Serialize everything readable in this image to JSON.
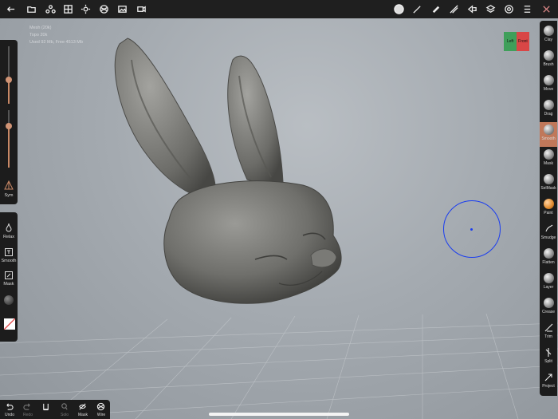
{
  "hud": {
    "line1": "Mesh (20k)",
    "line2": "Topo 20k",
    "line3": "Used 92 Mb, Free 4513 Mb"
  },
  "top_toolbar": {
    "left_icons": [
      "back-icon",
      "folder-icon",
      "scene-icon",
      "grid-icon",
      "sun-icon",
      "render-icon",
      "image-icon",
      "camera-icon"
    ],
    "right_icons": [
      "material-icon",
      "brush-icon",
      "pen-icon",
      "stroke-icon",
      "layers-icon",
      "settings-icon",
      "help-icon",
      "symmetry-icon"
    ]
  },
  "left_panel": {
    "slider1_level": 0.65,
    "slider2_level": 0.55,
    "sym_label": "Sym",
    "items": [
      {
        "label": "Relax",
        "icon": "drop-icon"
      },
      {
        "label": "Smooth",
        "icon": "smooth-square-icon"
      },
      {
        "label": "Mask",
        "icon": "mask-square-icon"
      }
    ]
  },
  "view_cube": {
    "left": "Left",
    "front": "Front"
  },
  "tools": [
    {
      "label": "Clay"
    },
    {
      "label": "Brush"
    },
    {
      "label": "Move"
    },
    {
      "label": "Drag"
    },
    {
      "label": "Smooth",
      "active": true
    },
    {
      "label": "Mask"
    },
    {
      "label": "SelMask"
    },
    {
      "label": "Paint"
    },
    {
      "label": "Smudge"
    },
    {
      "label": "Flatten"
    },
    {
      "label": "Layer"
    },
    {
      "label": "Crease"
    },
    {
      "label": "Trim"
    },
    {
      "label": "Split"
    },
    {
      "label": "Project"
    }
  ],
  "bottom_bar": [
    {
      "label": "Undo",
      "dim": false
    },
    {
      "label": "Redo",
      "dim": true
    },
    {
      "label": "",
      "dim": false
    },
    {
      "label": "Solo",
      "dim": true
    },
    {
      "label": "Mask",
      "dim": false
    },
    {
      "label": "Wire",
      "dim": false
    }
  ],
  "colors": {
    "accent": "#c0785a",
    "panel": "#1c1c1c",
    "brush_ring": "#1a3df0"
  }
}
